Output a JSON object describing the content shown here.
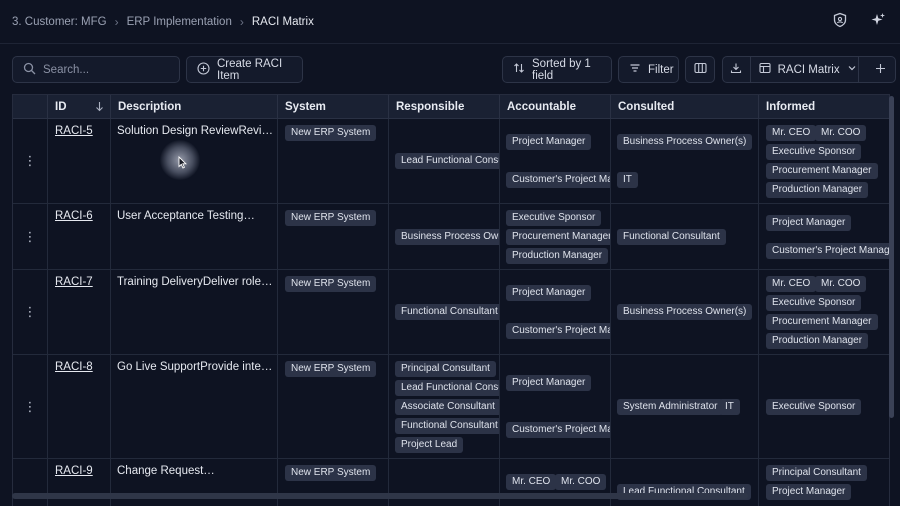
{
  "breadcrumb": [
    "3. Customer: MFG",
    "ERP Implementation",
    "RACI Matrix"
  ],
  "breadcrumb_sep": "›",
  "top_icons": [
    "shield-icon",
    "sparkles-icon"
  ],
  "toolbar": {
    "search_placeholder": "Search...",
    "create_label": "Create RACI Item",
    "sorted_label": "Sorted by 1 field",
    "filter_label": "Filter",
    "view_label": "RACI Matrix"
  },
  "columns": [
    "ID",
    "Description",
    "System",
    "Responsible",
    "Accountable",
    "Consulted",
    "Informed"
  ],
  "rows": [
    {
      "id": "RACI-5",
      "description": "Solution Design ReviewReview…",
      "system": "New ERP System",
      "responsible": [
        "Lead Functional Consultant"
      ],
      "accountable": [
        "Project Manager",
        "Customer's Project Manager"
      ],
      "consulted": [
        "Business Process Owner(s)",
        "IT"
      ],
      "informed": [
        "Mr. CEO",
        "Mr. COO",
        "Executive Sponsor",
        "Procurement Manager",
        "Production Manager"
      ]
    },
    {
      "id": "RACI-6",
      "description": "User Acceptance Testing…",
      "system": "New ERP System",
      "responsible": [
        "Business Process Owner(s)"
      ],
      "accountable": [
        "Executive Sponsor",
        "Procurement Manager",
        "Production Manager"
      ],
      "consulted": [
        "Functional Consultant"
      ],
      "informed": [
        "Project Manager",
        "Customer's Project Manager"
      ]
    },
    {
      "id": "RACI-7",
      "description": "Training DeliveryDeliver role-…",
      "system": "New ERP System",
      "responsible": [
        "Functional Consultant"
      ],
      "accountable": [
        "Project Manager",
        "Customer's Project Manager"
      ],
      "consulted": [
        "Business Process Owner(s)"
      ],
      "informed": [
        "Mr. CEO",
        "Mr. COO",
        "Executive Sponsor",
        "Procurement Manager",
        "Production Manager"
      ]
    },
    {
      "id": "RACI-8",
      "description": "Go Live SupportProvide intensiv…",
      "system": "New ERP System",
      "responsible": [
        "Principal Consultant",
        "Lead Functional Consultant",
        "Associate Consultant",
        "Functional Consultant",
        "Project Lead"
      ],
      "accountable": [
        "Project Manager",
        "Customer's Project Manager"
      ],
      "consulted": [
        "System Administrator",
        "IT"
      ],
      "informed": [
        "Executive Sponsor"
      ]
    },
    {
      "id": "RACI-9",
      "description": "Change Request…",
      "system": "New ERP System",
      "responsible": [],
      "accountable": [
        "Mr. CEO",
        "Mr. COO"
      ],
      "consulted": [
        "Lead Functional Consultant"
      ],
      "informed": [
        "Principal Consultant",
        "Project Manager"
      ]
    }
  ]
}
